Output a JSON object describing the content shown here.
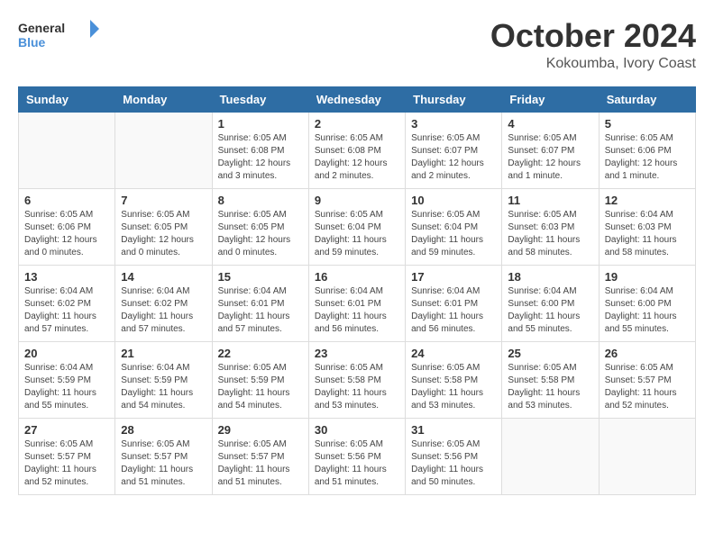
{
  "header": {
    "logo_general": "General",
    "logo_blue": "Blue",
    "month": "October 2024",
    "location": "Kokoumba, Ivory Coast"
  },
  "days_of_week": [
    "Sunday",
    "Monday",
    "Tuesday",
    "Wednesday",
    "Thursday",
    "Friday",
    "Saturday"
  ],
  "weeks": [
    [
      {
        "day": "",
        "info": ""
      },
      {
        "day": "",
        "info": ""
      },
      {
        "day": "1",
        "info": "Sunrise: 6:05 AM\nSunset: 6:08 PM\nDaylight: 12 hours\nand 3 minutes."
      },
      {
        "day": "2",
        "info": "Sunrise: 6:05 AM\nSunset: 6:08 PM\nDaylight: 12 hours\nand 2 minutes."
      },
      {
        "day": "3",
        "info": "Sunrise: 6:05 AM\nSunset: 6:07 PM\nDaylight: 12 hours\nand 2 minutes."
      },
      {
        "day": "4",
        "info": "Sunrise: 6:05 AM\nSunset: 6:07 PM\nDaylight: 12 hours\nand 1 minute."
      },
      {
        "day": "5",
        "info": "Sunrise: 6:05 AM\nSunset: 6:06 PM\nDaylight: 12 hours\nand 1 minute."
      }
    ],
    [
      {
        "day": "6",
        "info": "Sunrise: 6:05 AM\nSunset: 6:06 PM\nDaylight: 12 hours\nand 0 minutes."
      },
      {
        "day": "7",
        "info": "Sunrise: 6:05 AM\nSunset: 6:05 PM\nDaylight: 12 hours\nand 0 minutes."
      },
      {
        "day": "8",
        "info": "Sunrise: 6:05 AM\nSunset: 6:05 PM\nDaylight: 12 hours\nand 0 minutes."
      },
      {
        "day": "9",
        "info": "Sunrise: 6:05 AM\nSunset: 6:04 PM\nDaylight: 11 hours\nand 59 minutes."
      },
      {
        "day": "10",
        "info": "Sunrise: 6:05 AM\nSunset: 6:04 PM\nDaylight: 11 hours\nand 59 minutes."
      },
      {
        "day": "11",
        "info": "Sunrise: 6:05 AM\nSunset: 6:03 PM\nDaylight: 11 hours\nand 58 minutes."
      },
      {
        "day": "12",
        "info": "Sunrise: 6:04 AM\nSunset: 6:03 PM\nDaylight: 11 hours\nand 58 minutes."
      }
    ],
    [
      {
        "day": "13",
        "info": "Sunrise: 6:04 AM\nSunset: 6:02 PM\nDaylight: 11 hours\nand 57 minutes."
      },
      {
        "day": "14",
        "info": "Sunrise: 6:04 AM\nSunset: 6:02 PM\nDaylight: 11 hours\nand 57 minutes."
      },
      {
        "day": "15",
        "info": "Sunrise: 6:04 AM\nSunset: 6:01 PM\nDaylight: 11 hours\nand 57 minutes."
      },
      {
        "day": "16",
        "info": "Sunrise: 6:04 AM\nSunset: 6:01 PM\nDaylight: 11 hours\nand 56 minutes."
      },
      {
        "day": "17",
        "info": "Sunrise: 6:04 AM\nSunset: 6:01 PM\nDaylight: 11 hours\nand 56 minutes."
      },
      {
        "day": "18",
        "info": "Sunrise: 6:04 AM\nSunset: 6:00 PM\nDaylight: 11 hours\nand 55 minutes."
      },
      {
        "day": "19",
        "info": "Sunrise: 6:04 AM\nSunset: 6:00 PM\nDaylight: 11 hours\nand 55 minutes."
      }
    ],
    [
      {
        "day": "20",
        "info": "Sunrise: 6:04 AM\nSunset: 5:59 PM\nDaylight: 11 hours\nand 55 minutes."
      },
      {
        "day": "21",
        "info": "Sunrise: 6:04 AM\nSunset: 5:59 PM\nDaylight: 11 hours\nand 54 minutes."
      },
      {
        "day": "22",
        "info": "Sunrise: 6:05 AM\nSunset: 5:59 PM\nDaylight: 11 hours\nand 54 minutes."
      },
      {
        "day": "23",
        "info": "Sunrise: 6:05 AM\nSunset: 5:58 PM\nDaylight: 11 hours\nand 53 minutes."
      },
      {
        "day": "24",
        "info": "Sunrise: 6:05 AM\nSunset: 5:58 PM\nDaylight: 11 hours\nand 53 minutes."
      },
      {
        "day": "25",
        "info": "Sunrise: 6:05 AM\nSunset: 5:58 PM\nDaylight: 11 hours\nand 53 minutes."
      },
      {
        "day": "26",
        "info": "Sunrise: 6:05 AM\nSunset: 5:57 PM\nDaylight: 11 hours\nand 52 minutes."
      }
    ],
    [
      {
        "day": "27",
        "info": "Sunrise: 6:05 AM\nSunset: 5:57 PM\nDaylight: 11 hours\nand 52 minutes."
      },
      {
        "day": "28",
        "info": "Sunrise: 6:05 AM\nSunset: 5:57 PM\nDaylight: 11 hours\nand 51 minutes."
      },
      {
        "day": "29",
        "info": "Sunrise: 6:05 AM\nSunset: 5:57 PM\nDaylight: 11 hours\nand 51 minutes."
      },
      {
        "day": "30",
        "info": "Sunrise: 6:05 AM\nSunset: 5:56 PM\nDaylight: 11 hours\nand 51 minutes."
      },
      {
        "day": "31",
        "info": "Sunrise: 6:05 AM\nSunset: 5:56 PM\nDaylight: 11 hours\nand 50 minutes."
      },
      {
        "day": "",
        "info": ""
      },
      {
        "day": "",
        "info": ""
      }
    ]
  ]
}
